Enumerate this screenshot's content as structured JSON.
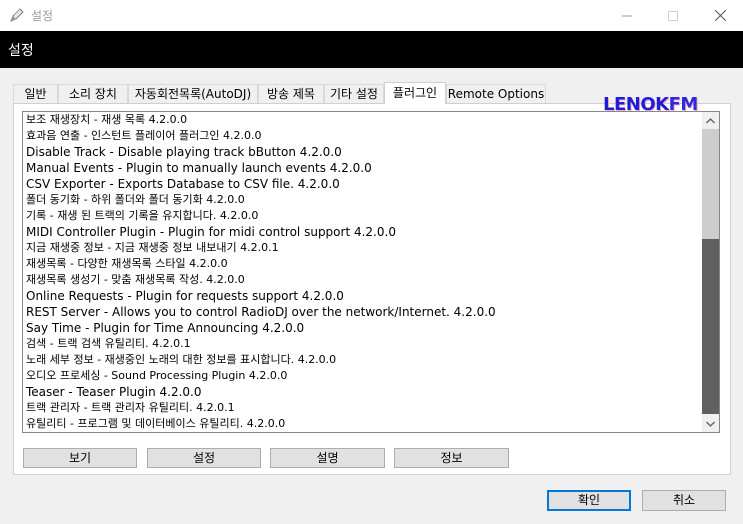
{
  "window": {
    "title": "설정"
  },
  "header": {
    "title": "설정"
  },
  "tabs": [
    {
      "label": "일반"
    },
    {
      "label": "소리 장치"
    },
    {
      "label": "자동회전목록(AutoDJ)"
    },
    {
      "label": "방송 제목"
    },
    {
      "label": "기타 설정"
    },
    {
      "label": "플러그인"
    },
    {
      "label": "Remote Options"
    }
  ],
  "logo": {
    "main": "LENOK",
    "suffix": "FM"
  },
  "plugins": [
    "보조 재생장치 -  재생 목록 4.2.0.0",
    "효과음 연출 - 인스턴트 플레이어 플러그인 4.2.0.0",
    "Disable Track - Disable playing track bButton 4.2.0.0",
    "Manual Events - Plugin to manually launch events 4.2.0.0",
    "CSV Exporter - Exports Database to CSV file. 4.2.0.0",
    "폴더 동기화 - 하위 폴더와 폴더 동기화 4.2.0.0",
    "기록 - 재생 된 트랙의 기록을 유지합니다. 4.2.0.0",
    "MIDI Controller Plugin - Plugin for midi control support 4.2.0.0",
    "지금 재생중 정보 - 지금 재생중 정보 내보내기 4.2.0.1",
    "재생목록 - 다양한 재생목록 스타일 4.2.0.0",
    "재생목록 생성기 - 맞춤 재생목록 작성. 4.2.0.0",
    "Online Requests - Plugin for requests support 4.2.0.0",
    "REST Server - Allows you to control RadioDJ over the network/Internet. 4.2.0.0",
    "Say Time - Plugin for Time Announcing 4.2.0.0",
    "검색 - 트랙 검색 유틸리티. 4.2.0.1",
    "노래 세부 정보 - 재생중인 노래의 대한 정보를 표시합니다. 4.2.0.0",
    "오디오 프로세싱 - Sound Processing Plugin 4.2.0.0",
    "Teaser - Teaser Plugin 4.2.0.0",
    "트랙 관리자 - 트랙 관리자 유틸리티. 4.2.0.1",
    "유틸리티 - 프로그램 및 데이터베이스 유틸리티. 4.2.0.0"
  ],
  "plugin_buttons": {
    "view": "보기",
    "settings": "설정",
    "description": "설명",
    "info": "정보"
  },
  "dialog_buttons": {
    "ok": "확인",
    "cancel": "취소"
  }
}
